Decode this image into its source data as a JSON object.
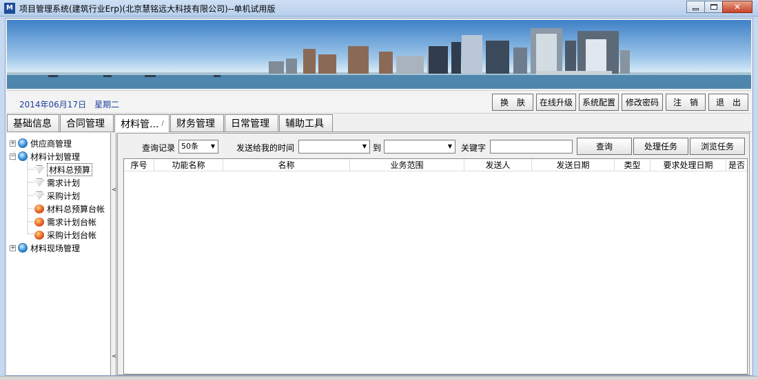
{
  "window": {
    "title": "项目管理系统(建筑行业Erp)(北京慧铭远大科技有限公司)--单机试用版",
    "icon_text": "M"
  },
  "header": {
    "date": "2014年06月17日",
    "weekday": "星期二",
    "buttons": [
      "换　肤",
      "在线升级",
      "系统配置",
      "修改密码",
      "注　销",
      "退　出"
    ]
  },
  "tabs": [
    {
      "label": "基础信息"
    },
    {
      "label": "合同管理"
    },
    {
      "label": "材料管..."
    },
    {
      "label": "财务管理"
    },
    {
      "label": "日常管理"
    },
    {
      "label": "辅助工具"
    }
  ],
  "tree": {
    "items": [
      {
        "label": "供应商管理",
        "icon": "globe-icon",
        "expander": "+"
      },
      {
        "label": "材料计划管理",
        "icon": "globe-icon",
        "expander": "−"
      },
      {
        "label": "材料总预算",
        "icon": "gem-icon"
      },
      {
        "label": "需求计划",
        "icon": "gem-icon"
      },
      {
        "label": "采购计划",
        "icon": "gem-icon"
      },
      {
        "label": "材料总预算台帐",
        "icon": "apple-icon"
      },
      {
        "label": "需求计划台帐",
        "icon": "apple-icon"
      },
      {
        "label": "采购计划台帐",
        "icon": "apple-icon"
      },
      {
        "label": "材料现场管理",
        "icon": "globe-icon",
        "expander": "+"
      }
    ]
  },
  "query": {
    "records_label": "查询记录",
    "records_value": "50条",
    "sent_time_label": "发送给我的时间",
    "to_label": "到",
    "keyword_label": "关键字",
    "keyword_value": "",
    "buttons": [
      "查询",
      "处理任务",
      "浏览任务"
    ]
  },
  "grid": {
    "columns": [
      "序号",
      "功能名称",
      "名称",
      "业务范围",
      "发送人",
      "发送日期",
      "类型",
      "要求处理日期",
      "是否"
    ]
  },
  "colors": {
    "date_text": "#1a3f9a",
    "banner_sky": "#3e80c7"
  }
}
